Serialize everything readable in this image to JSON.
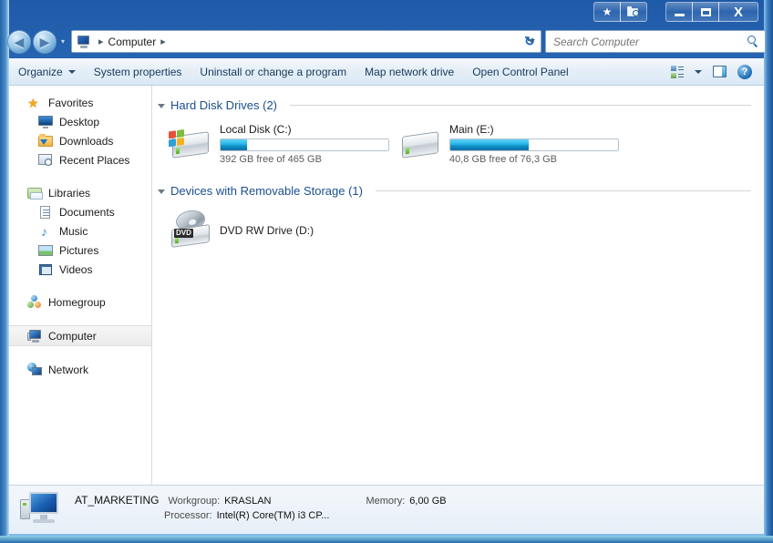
{
  "titlebar": {
    "caption_buttons": [
      {
        "name": "favorites-button",
        "glyph": "★"
      },
      {
        "name": "history-button",
        "glyph": "὜0"
      }
    ],
    "minimize_label": "Minimize",
    "maximize_label": "Maximize",
    "close_label": "X"
  },
  "navbar": {
    "back_glyph": "◀",
    "forward_glyph": "▶",
    "address": {
      "icon": "computer-icon",
      "crumbs": [
        "Computer"
      ],
      "separator": "▸",
      "leading_separator": "▸"
    },
    "refresh_glyph": "↻",
    "search": {
      "placeholder": "Search Computer",
      "value": ""
    }
  },
  "toolbar": {
    "items": [
      {
        "label": "Organize",
        "has_caret": true
      },
      {
        "label": "System properties",
        "has_caret": false
      },
      {
        "label": "Uninstall or change a program",
        "has_caret": false
      },
      {
        "label": "Map network drive",
        "has_caret": false
      },
      {
        "label": "Open Control Panel",
        "has_caret": false
      }
    ],
    "views_label": "Change your view",
    "preview_label": "Show the preview pane",
    "help_label": "?"
  },
  "sidebar": {
    "groups": [
      {
        "header": {
          "label": "Favorites",
          "icon": "star-icon"
        },
        "items": [
          {
            "label": "Desktop",
            "icon": "desktop-icon"
          },
          {
            "label": "Downloads",
            "icon": "downloads-folder-icon"
          },
          {
            "label": "Recent Places",
            "icon": "recent-places-icon"
          }
        ]
      },
      {
        "header": {
          "label": "Libraries",
          "icon": "libraries-icon"
        },
        "items": [
          {
            "label": "Documents",
            "icon": "documents-icon"
          },
          {
            "label": "Music",
            "icon": "music-icon"
          },
          {
            "label": "Pictures",
            "icon": "pictures-icon"
          },
          {
            "label": "Videos",
            "icon": "videos-icon"
          }
        ]
      },
      {
        "header": {
          "label": "Homegroup",
          "icon": "homegroup-icon"
        },
        "items": []
      },
      {
        "header": {
          "label": "Computer",
          "icon": "computer-icon",
          "selected": true
        },
        "items": []
      },
      {
        "header": {
          "label": "Network",
          "icon": "network-icon"
        },
        "items": []
      }
    ]
  },
  "content": {
    "groups": [
      {
        "title": "Hard Disk Drives (2)",
        "expanded": true,
        "tiles": [
          {
            "name": "Local Disk (C:)",
            "icon": "system-hard-drive-icon",
            "has_progress": true,
            "used_percent": 16,
            "free_text": "392 GB free of 465 GB",
            "free_value": "392 GB",
            "total_value": "465 GB"
          },
          {
            "name": "Main (E:)",
            "icon": "hard-drive-icon",
            "has_progress": true,
            "used_percent": 47,
            "free_text": "40,8 GB free of 76,3 GB",
            "free_value": "40,8 GB",
            "total_value": "76,3 GB"
          }
        ]
      },
      {
        "title": "Devices with Removable Storage (1)",
        "expanded": true,
        "tiles": [
          {
            "name": "DVD RW Drive (D:)",
            "icon": "dvd-drive-icon",
            "icon_badge": "DVD",
            "has_progress": false,
            "free_text": ""
          }
        ]
      }
    ]
  },
  "statusbar": {
    "icon": "computer-icon",
    "computer_name": "AT_MARKETING",
    "workgroup_label": "Workgroup:",
    "workgroup_value": "KRASLAN",
    "memory_label": "Memory:",
    "memory_value": "6,00 GB",
    "processor_label": "Processor:",
    "processor_value": "Intel(R) Core(TM) i3 CP..."
  }
}
